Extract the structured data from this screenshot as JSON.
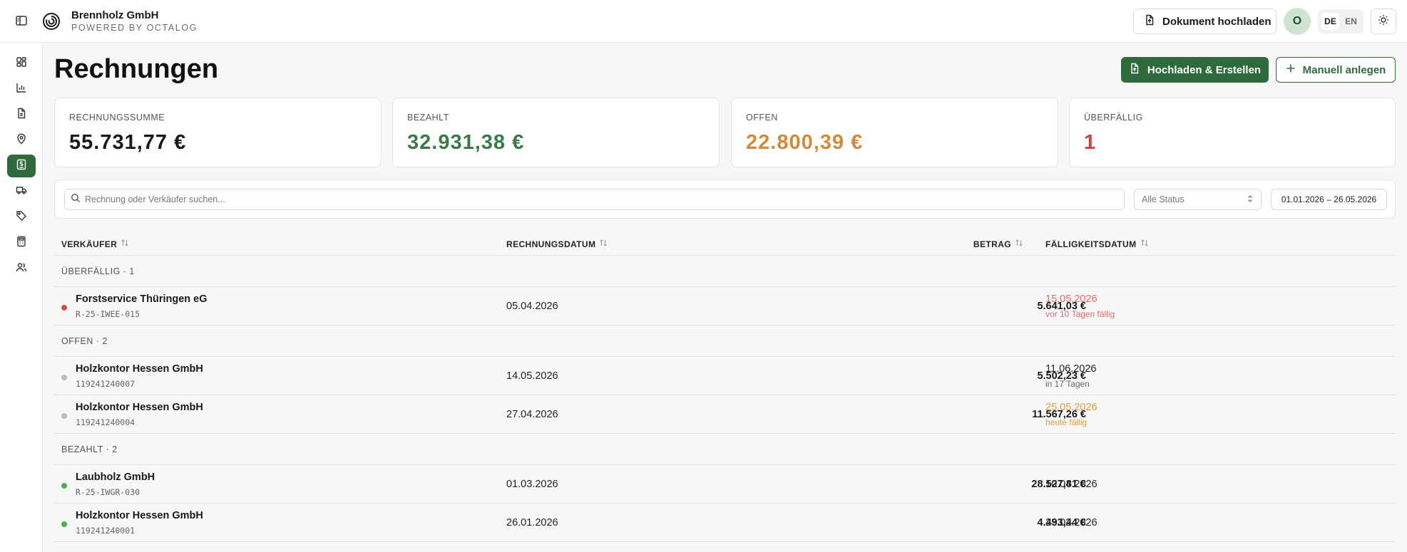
{
  "brand": {
    "name": "Brennholz GmbH",
    "tagline": "POWERED BY OCTALOG"
  },
  "header": {
    "upload_doc_label": "Dokument hochladen",
    "avatar_initial": "O",
    "languages": [
      "DE",
      "EN"
    ],
    "active_language": "DE"
  },
  "nav": {
    "icons": [
      "dashboard-icon",
      "bar-chart-icon",
      "document-icon",
      "map-pin-icon",
      "invoice-icon",
      "truck-icon",
      "tag-icon",
      "calculator-icon",
      "users-icon"
    ],
    "active": "invoice-icon"
  },
  "page": {
    "title": "Rechnungen",
    "primary_action": "Hochladen & Erstellen",
    "secondary_action": "Manuell anlegen"
  },
  "stats": [
    {
      "label": "Rechnungssumme",
      "value": "55.731,77 €",
      "color": "#1a1a1a"
    },
    {
      "label": "Bezahlt",
      "value": "32.931,38 €",
      "color": "#3a7a4a"
    },
    {
      "label": "Offen",
      "value": "22.800,39 €",
      "color": "#d08a3a"
    },
    {
      "label": "Überfällig",
      "value": "1",
      "color": "#d04040"
    }
  ],
  "filters": {
    "search_placeholder": "Rechnung oder Verkäufer suchen...",
    "status_value": "Alle Status",
    "date_range": "01.01.2026 – 26.05.2026"
  },
  "table": {
    "columns": {
      "vendor": "Verkäufer",
      "invoice_date": "Rechnungsdatum",
      "amount": "Betrag",
      "due_date": "Fälligkeitsdatum"
    },
    "groups": [
      {
        "label": "Überfällig · 1",
        "rows": [
          {
            "vendor": "Forstservice Thüringen eG",
            "invoice_no": "R-25-IWEE-015",
            "invoice_date": "05.04.2026",
            "amount": "5.641,03 €",
            "due_date": "15.05.2026",
            "due_note": "vor 10 Tagen fällig",
            "dot_color": "#e04848",
            "due_color": "#e06a6a",
            "note_color": "#e06a6a"
          }
        ]
      },
      {
        "label": "Offen · 2",
        "rows": [
          {
            "vendor": "Holzkontor Hessen GmbH",
            "invoice_no": "119241240007",
            "invoice_date": "14.05.2026",
            "amount": "5.502,23 €",
            "due_date": "11.06.2026",
            "due_note": "in 17 Tagen",
            "dot_color": "#bdbdbd",
            "due_color": "#222222",
            "note_color": "#666666"
          },
          {
            "vendor": "Holzkontor Hessen GmbH",
            "invoice_no": "119241240004",
            "invoice_date": "27.04.2026",
            "amount": "11.567,26 €",
            "due_date": "25.05.2026",
            "due_note": "heute fällig",
            "dot_color": "#bdbdbd",
            "due_color": "#e09a3a",
            "note_color": "#e09a3a"
          }
        ]
      },
      {
        "label": "Bezahlt · 2",
        "rows": [
          {
            "vendor": "Laubholz GmbH",
            "invoice_no": "R-25-IWGR-030",
            "invoice_date": "01.03.2026",
            "amount": "28.527,81 €",
            "due_date": "10.04.2026",
            "due_note": "",
            "dot_color": "#4caf50",
            "due_color": "#222222",
            "note_color": "#666666"
          },
          {
            "vendor": "Holzkontor Hessen GmbH",
            "invoice_no": "119241240001",
            "invoice_date": "26.01.2026",
            "amount": "4.493,44 €",
            "due_date": "23.02.2026",
            "due_note": "",
            "dot_color": "#4caf50",
            "due_color": "#222222",
            "note_color": "#666666"
          }
        ]
      }
    ]
  }
}
